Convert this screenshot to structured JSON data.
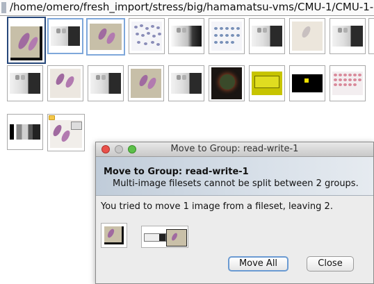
{
  "path": {
    "text": "/home/omero/fresh_import/stress/big/hamamatsu-vms/CMU-1/CMU-1-"
  },
  "dialog": {
    "title": "Move to Group: read-write-1",
    "heading": "Move to Group: read-write-1",
    "subheading": "Multi-image filesets cannot be split between 2 groups.",
    "message": "You tried to move 1 image from a fileset, leaving 2.",
    "move_all_label": "Move All",
    "close_label": "Close"
  },
  "colors": {
    "selection_dark": "#26477a",
    "selection_light": "#7ea7da",
    "close_light": "#e9514b",
    "min_light": "#c8c8c8",
    "max_light": "#5cc04a"
  }
}
